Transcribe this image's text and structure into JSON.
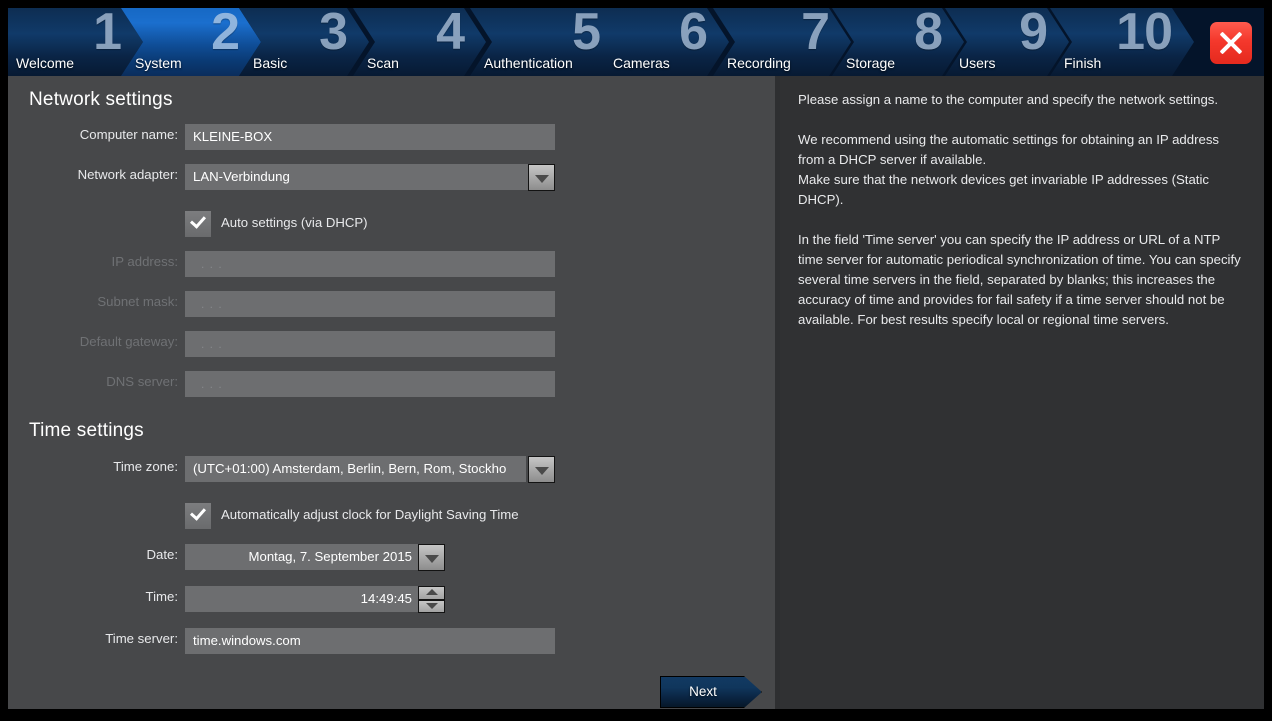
{
  "wizard": {
    "tabs": [
      {
        "number": "1",
        "label": "Welcome",
        "active": false
      },
      {
        "number": "2",
        "label": "System",
        "active": true
      },
      {
        "number": "3",
        "label": "Basic",
        "active": false
      },
      {
        "number": "4",
        "label": "Scan",
        "active": false
      },
      {
        "number": "5",
        "label": "Authentication",
        "active": false
      },
      {
        "number": "6",
        "label": "Cameras",
        "active": false
      },
      {
        "number": "7",
        "label": "Recording",
        "active": false
      },
      {
        "number": "8",
        "label": "Storage",
        "active": false
      },
      {
        "number": "9",
        "label": "Users",
        "active": false
      },
      {
        "number": "10",
        "label": "Finish",
        "active": false
      }
    ],
    "close_icon": "close-icon",
    "next_label": "Next"
  },
  "network": {
    "title": "Network settings",
    "computer_name": {
      "label": "Computer name:",
      "value": "KLEINE-BOX"
    },
    "network_adapter": {
      "label": "Network adapter:",
      "value": "LAN-Verbindung",
      "dropdown_icon": "chevron-down-icon"
    },
    "auto_dhcp": {
      "label": "Auto settings (via DHCP)",
      "checked": true,
      "check_icon": "check-icon"
    },
    "ip_address": {
      "label": "IP address:",
      "value": ".   .   .",
      "disabled": true
    },
    "subnet_mask": {
      "label": "Subnet mask:",
      "value": ".   .   .",
      "disabled": true
    },
    "default_gateway": {
      "label": "Default gateway:",
      "value": ".   .   .",
      "disabled": true
    },
    "dns_server": {
      "label": "DNS server:",
      "value": ".   .   .",
      "disabled": true
    }
  },
  "time": {
    "title": "Time settings",
    "time_zone": {
      "label": "Time zone:",
      "value": "(UTC+01:00) Amsterdam, Berlin, Bern, Rom, Stockho",
      "dropdown_icon": "chevron-down-icon"
    },
    "dst": {
      "label": "Automatically adjust clock for Daylight Saving Time",
      "checked": true,
      "check_icon": "check-icon"
    },
    "date": {
      "label": "Date:",
      "value": "Montag, 7. September 2015",
      "dropdown_icon": "chevron-down-icon"
    },
    "clock": {
      "label": "Time:",
      "value": "14:49:45",
      "up_icon": "chevron-up-icon",
      "down_icon": "chevron-down-icon"
    },
    "time_server": {
      "label": "Time server:",
      "value": "time.windows.com"
    }
  },
  "help": {
    "paragraphs": [
      "Please assign a name to the computer and specify the network settings.",
      "We recommend using the automatic settings for obtaining an IP address from a DHCP server if available.\nMake sure that the network devices get invariable IP addresses (Static DHCP).",
      "In the field 'Time server' you can specify the IP address or URL of a NTP time server for automatic periodical synchronization of time. You can specify several time servers in the field, separated by blanks; this increases the accuracy of time and provides for fail safety if a time server should not be available. For best results specify local or regional time servers."
    ]
  }
}
